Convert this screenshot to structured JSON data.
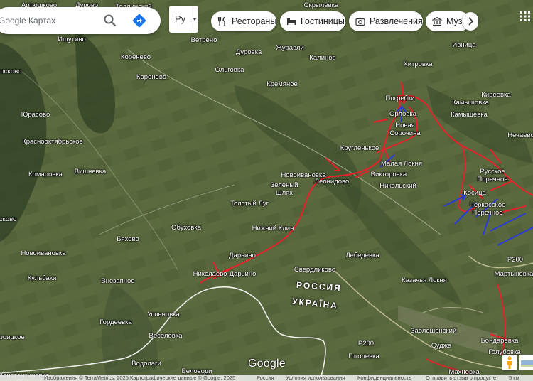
{
  "search": {
    "placeholder": "Google Картах"
  },
  "layer_button": {
    "label": "Ру"
  },
  "chips": [
    {
      "label": "Рестораны",
      "icon": "fork-knife-icon"
    },
    {
      "label": "Гостиницы",
      "icon": "bed-icon"
    },
    {
      "label": "Развлечения",
      "icon": "camera-icon"
    },
    {
      "label": "Музеи",
      "icon": "museum-icon"
    }
  ],
  "places": [
    {
      "name": "Артюшково"
    },
    {
      "name": "Дурово"
    },
    {
      "name": "Толлинский"
    },
    {
      "name": "Скрылёвка"
    },
    {
      "name": "Ищутино"
    },
    {
      "name": "Ветрено"
    },
    {
      "name": "Журавли"
    },
    {
      "name": "Ивница"
    },
    {
      "name": "Коренево"
    },
    {
      "name": "Дуровка"
    },
    {
      "name": "Калинов"
    },
    {
      "name": "Хитровка"
    },
    {
      "name": "Сосково"
    },
    {
      "name": "Ольговка"
    },
    {
      "name": "Коренево"
    },
    {
      "name": "Кремяное"
    },
    {
      "name": "Погребки"
    },
    {
      "name": "Камышовка"
    },
    {
      "name": "Киреевка"
    },
    {
      "name": "Юрасово"
    },
    {
      "name": "Орловка"
    },
    {
      "name": "Камышевка"
    },
    {
      "name": "Новая Сорочина"
    },
    {
      "name": "Нечаево"
    },
    {
      "name": "Краснооктябрьское"
    },
    {
      "name": "Кругленькое"
    },
    {
      "name": "Вишневка"
    },
    {
      "name": "Малая Локня"
    },
    {
      "name": "Русское Поречное"
    },
    {
      "name": "Комаровка"
    },
    {
      "name": "Новоивановка"
    },
    {
      "name": "Викторовка"
    },
    {
      "name": "Зеленый Шлях"
    },
    {
      "name": "Леонидово"
    },
    {
      "name": "Никольский"
    },
    {
      "name": "Косица"
    },
    {
      "name": "Толстый Луг"
    },
    {
      "name": "Черкасское Поречное"
    },
    {
      "name": "Сосково"
    },
    {
      "name": "Обуховка"
    },
    {
      "name": "Нижний Клин"
    },
    {
      "name": "Бяхово"
    },
    {
      "name": "Новоивановка"
    },
    {
      "name": "Дарьино"
    },
    {
      "name": "Лебедевка"
    },
    {
      "name": "Р200"
    },
    {
      "name": "Свердликово"
    },
    {
      "name": "Мартыновка"
    },
    {
      "name": "Кульбаки"
    },
    {
      "name": "Внезапное"
    },
    {
      "name": "Николаево-Дарьино"
    },
    {
      "name": "Казачья Локня"
    },
    {
      "name": "Успеновка"
    },
    {
      "name": "Гордеевка"
    },
    {
      "name": "Заолешенский"
    },
    {
      "name": "Бондаревка"
    },
    {
      "name": "Веселовка"
    },
    {
      "name": "Голубовка"
    },
    {
      "name": "Троицкое"
    },
    {
      "name": "Р200"
    },
    {
      "name": "Гоголевка"
    },
    {
      "name": "Суджа"
    },
    {
      "name": "Водолаги"
    },
    {
      "name": "Константиновка"
    },
    {
      "name": "Беловоди"
    },
    {
      "name": "Махновка"
    }
  ],
  "countries": {
    "russia": "РОССИЯ",
    "ukraine": "УКРАЇНА"
  },
  "logo": "Google",
  "footer": {
    "attribution": "Изображения © TerraMetrics, 2025,Картографические данные © Google, 2025",
    "links": [
      "Россия",
      "Условия использования",
      "Конфиденциальность",
      "Отправить отзыв о продукте"
    ],
    "scale": "5 км"
  },
  "colors": {
    "front_line": "#e8202a",
    "russian_arrows": "#e8202a",
    "ukrainian_arrows": "#2b3bd9",
    "border": "#ffffff",
    "terrain": "#55633b"
  }
}
